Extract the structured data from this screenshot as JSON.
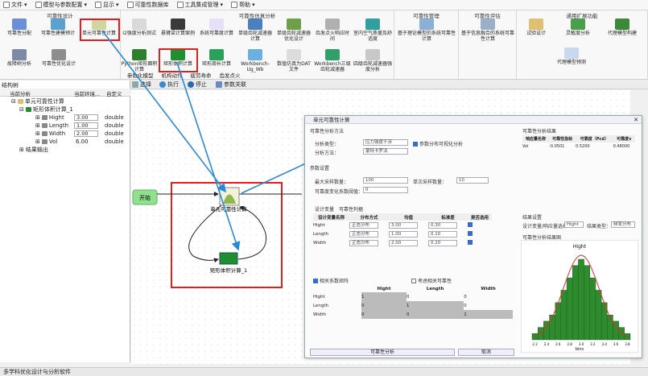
{
  "menu": [
    "文件",
    "模型与参数配置",
    "显示",
    "可靠性数据库",
    "工具集成管理",
    "帮助"
  ],
  "ribbon": {
    "groups": [
      "可靠性设计",
      "可靠性仿真分析",
      "可靠性管理",
      "可靠性评估",
      "通用扩展功能"
    ],
    "design": [
      "可靠性分配",
      "可靠性建模预计",
      "单元可靠性计算",
      "故障树分析",
      "可靠性优化设计"
    ],
    "sim_row1": [
      "I2强度分析测试",
      "悬臂梁计算案例",
      "系统可靠度计算",
      "单级齿轮减速器计算",
      "单级齿轮减速器优化设计",
      "齿发点火响应时间",
      "室内空气质量及舒适度"
    ],
    "sim_row2": [
      "Python矩形面积计算",
      "矩形体积计算",
      "矩形周长计算",
      "Workbench-Ug_Wb",
      "数值仿真为DAT文件",
      "Workbench三级齿轮减速器",
      "四级齿轮减速器强度分析"
    ],
    "eval": [
      "基于理论模型的系统可靠性计算",
      "基于信息融合的系统可靠性计算"
    ],
    "ext": [
      "试验设计",
      "灵敏度分析",
      "代理模型构建",
      "代理模型预测"
    ]
  },
  "subtabs": [
    "参数化模型",
    "机构动作",
    "疲劳寿命",
    "齿发点火"
  ],
  "toolbar": {
    "select": "选择",
    "run": "执行",
    "stop": "停止",
    "params": "参数关联"
  },
  "tree": {
    "title": "结构树",
    "cols": [
      "当前分析",
      "当前环境...",
      "自定义"
    ],
    "root": "单元可靠性计算",
    "child": "矩形体积计算_1",
    "params": [
      {
        "name": "Hight",
        "value": "3.00",
        "type": "double"
      },
      {
        "name": "Length",
        "value": "1.00",
        "type": "double"
      },
      {
        "name": "Width",
        "value": "2.00",
        "type": "double"
      },
      {
        "name": "Vol",
        "value": "6.00",
        "type": "double"
      }
    ],
    "output": "结果输出"
  },
  "flow": {
    "start": "开始",
    "node1": "单元可靠性计算",
    "node2": "矩形体积计算_1"
  },
  "dialog": {
    "title": "单元可靠性计算",
    "sec_method": "可靠性分析方法",
    "lbl_analysis": "分析类型：",
    "val_analysis": "应力强度干涉",
    "chk_param": "参数分布可视化分析",
    "lbl_method": "分析方法：",
    "val_method": "蒙特卡罗法",
    "sec_params": "参数设置",
    "lbl_max": "最大采样数量：",
    "val_max": "100",
    "lbl_step": "单次采样数量：",
    "val_step": "10",
    "lbl_out": "可靠度变化系数阈值：",
    "val_out": "0",
    "tabs": [
      "设计变量",
      "可靠性判据"
    ],
    "var_cols": [
      "设计变量名称",
      "分布方式",
      "均值",
      "标准差",
      "是否选用"
    ],
    "vars": [
      {
        "name": "Hight",
        "dist": "正态分布",
        "mean": "3.00",
        "std": "0.30"
      },
      {
        "name": "Length",
        "dist": "正态分布",
        "mean": "1.00",
        "std": "0.10"
      },
      {
        "name": "Width",
        "dist": "正态分布",
        "mean": "2.00",
        "std": "0.20"
      }
    ],
    "chk_corr": "相关系数矩阵",
    "chk_other": "考虑相关可靠性",
    "corr_cols": [
      "Hight",
      "Length",
      "Width"
    ],
    "corr_rows": [
      {
        "name": "Hight",
        "vals": [
          "1",
          "0",
          "0"
        ]
      },
      {
        "name": "Length",
        "vals": [
          "0",
          "1",
          "0"
        ]
      },
      {
        "name": "Width",
        "vals": [
          "0",
          "0",
          "1"
        ]
      }
    ],
    "btn_run": "可靠性分析",
    "btn_cancel": "取消",
    "result_title": "可靠性分析结果",
    "result_cols": [
      "响应量名称",
      "可靠性指标",
      "可靠度（Pcd）",
      "可靠度v"
    ],
    "result_row": [
      "Vol",
      "-0.0501",
      "0.5200",
      "0.48000"
    ],
    "sec_result": "结果设置",
    "lbl_resp": "设计变量/响应量选择：",
    "val_resp": "Hight",
    "lbl_type": "结果类型：",
    "val_type": "频率分布",
    "hist_title": "可靠性分析结果图",
    "hist_chart_title": "Hight",
    "hist_x": "bins"
  },
  "chart_data": {
    "type": "bar",
    "title": "Hight",
    "xlabel": "bins",
    "categories": [
      "2.2",
      "2.3",
      "2.4",
      "2.5",
      "2.6",
      "2.7",
      "2.8",
      "2.9",
      "3.0",
      "3.1",
      "3.2",
      "3.3",
      "3.4",
      "3.5",
      "3.6",
      "3.7",
      "3.8"
    ],
    "values": [
      0.1,
      0.2,
      0.3,
      0.4,
      0.6,
      0.8,
      1.0,
      1.2,
      1.3,
      1.2,
      1.0,
      0.8,
      0.6,
      0.4,
      0.3,
      0.2,
      0.1
    ],
    "bar_color": "#2e8b2e",
    "curve_color": "#e03030"
  },
  "status": "多学科优化设计与分析软件"
}
